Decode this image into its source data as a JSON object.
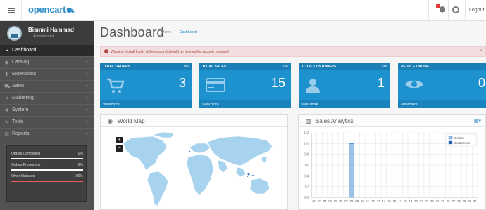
{
  "header": {
    "logo_text": "opencart",
    "logo_cart": " ʟ",
    "logout": "Logout",
    "icons": [
      "menu-icon",
      "bell-icon",
      "help-icon"
    ]
  },
  "sidebar": {
    "user": {
      "name": "Bismmi Hammad",
      "role": "Administrator"
    },
    "items": [
      {
        "label": "Dashboard",
        "icon": "dashboard-icon",
        "active": true
      },
      {
        "label": "Catalog",
        "icon": "tag-icon",
        "active": false
      },
      {
        "label": "Extensions",
        "icon": "puzzle-icon",
        "active": false
      },
      {
        "label": "Sales",
        "icon": "cart-icon",
        "active": false
      },
      {
        "label": "Marketing",
        "icon": "share-icon",
        "active": false
      },
      {
        "label": "System",
        "icon": "gear-icon",
        "active": false
      },
      {
        "label": "Tools",
        "icon": "wrench-icon",
        "active": false
      },
      {
        "label": "Reports",
        "icon": "bar-chart-icon",
        "active": false
      }
    ],
    "stats": [
      {
        "label": "Orders Completed",
        "pct": "0%",
        "fill": 0
      },
      {
        "label": "Orders Processing",
        "pct": "0%",
        "fill": 0
      },
      {
        "label": "Other Statuses",
        "pct": "100%",
        "fill": 1
      }
    ]
  },
  "page": {
    "title": "Dashboard",
    "breadcrumb_home": "Home",
    "breadcrumb_sep": "/",
    "breadcrumb_current": "Dashboard"
  },
  "alert": {
    "text": "Warning: Install folder still exists and should be deleted for security reasons!",
    "close": "×"
  },
  "tiles": [
    {
      "title": "TOTAL ORDERS",
      "pct": "0%",
      "value": "3",
      "more": "View more...",
      "icon": "cart-icon"
    },
    {
      "title": "TOTAL SALES",
      "pct": "0%",
      "value": "15",
      "more": "View more...",
      "icon": "credit-card-icon"
    },
    {
      "title": "TOTAL CUSTOMERS",
      "pct": "0%",
      "value": "1",
      "more": "View more...",
      "icon": "user-icon"
    },
    {
      "title": "PEOPLE ONLINE",
      "pct": "",
      "value": "0",
      "more": "View more...",
      "icon": "eye-icon"
    }
  ],
  "world_map": {
    "title": "World Map",
    "zoom_in": "+",
    "zoom_out": "−"
  },
  "sales_analytics": {
    "title": "Sales Analytics",
    "calendar_label": "▾"
  },
  "chart_data": {
    "type": "bar",
    "x": [
      "01",
      "02",
      "03",
      "04",
      "05",
      "06",
      "07",
      "08",
      "09",
      "10",
      "11",
      "12",
      "13",
      "14",
      "15",
      "16",
      "17",
      "18",
      "19",
      "20",
      "21",
      "22",
      "23",
      "24",
      "25",
      "26",
      "27",
      "28",
      "29",
      "30",
      "31"
    ],
    "series": [
      {
        "name": "Orders",
        "values": [
          0,
          0,
          0,
          0,
          0,
          0,
          0,
          1,
          0,
          0,
          0,
          0,
          0,
          0,
          0,
          0,
          0,
          0,
          0,
          0,
          0,
          0,
          0,
          0,
          0,
          0,
          0,
          0,
          0,
          0,
          0
        ]
      },
      {
        "name": "Customers",
        "values": [
          0,
          0,
          0,
          0,
          0,
          0,
          0,
          0,
          0,
          0,
          0,
          0,
          0,
          0,
          0,
          0,
          0,
          0,
          0,
          0,
          0,
          0,
          0,
          0,
          0,
          0,
          0,
          0,
          0,
          0,
          0
        ]
      }
    ],
    "yticks": [
      "1.2",
      "1.0",
      "0.8",
      "0.6",
      "0.4",
      "0.2",
      "0.0"
    ],
    "ylim": [
      0,
      1.2
    ],
    "grid": true,
    "legend_position": "top-right",
    "colors": {
      "Orders": "#9cc2e8",
      "Customers": "#1f5eb4"
    }
  },
  "colors": {
    "tile": "#1e91cf",
    "sidebar": "#515151",
    "accent": "#2d8cc8",
    "alert": "#f2dede"
  }
}
